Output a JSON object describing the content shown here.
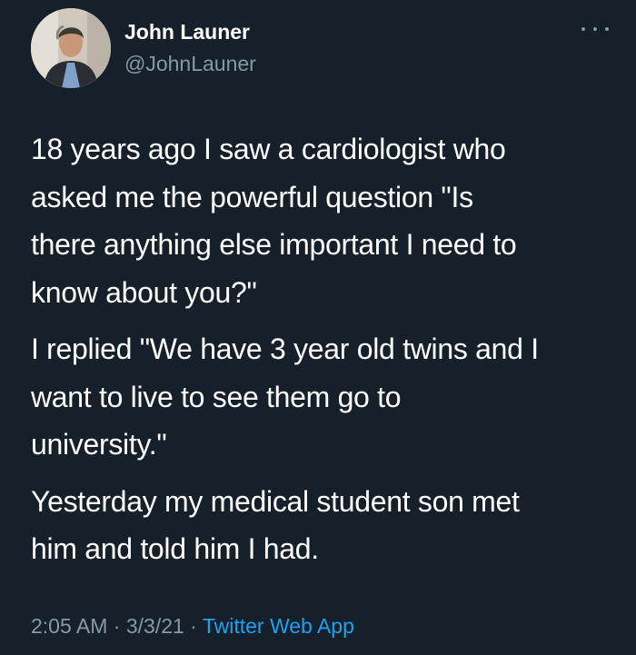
{
  "author": {
    "name": "John Launer",
    "handle": "@JohnLauner"
  },
  "tweet": {
    "paragraphs": [
      [
        "18 years ago I saw a cardiologist who",
        "asked me the powerful question \"Is",
        "there anything else important I need to",
        "know about you?\""
      ],
      [
        "I replied \"We have 3 year old twins and I",
        "want to live to see them go to",
        "university.\""
      ],
      [
        "Yesterday my medical student son met",
        "him and told him I had."
      ]
    ]
  },
  "meta": {
    "time": "2:05 AM",
    "separator": " · ",
    "date": "3/3/21",
    "source": "Twitter Web App"
  },
  "icons": {
    "more": "more-horizontal-icon"
  },
  "colors": {
    "background": "#15202b",
    "text": "#ffffff",
    "secondary": "#8899a6",
    "link": "#1da1f2"
  }
}
